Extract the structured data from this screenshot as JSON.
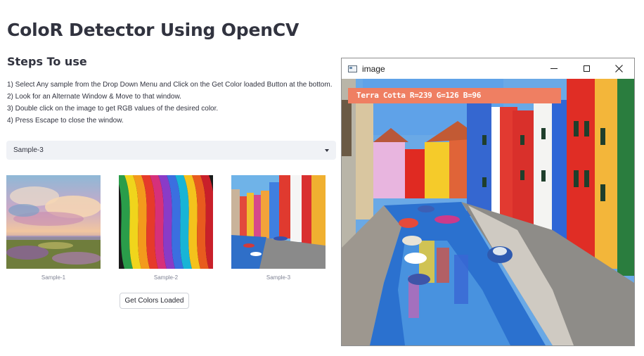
{
  "page": {
    "title": "ColoR Detector Using OpenCV",
    "steps_heading": "Steps To use",
    "steps": [
      "1) Select Any sample from the Drop Down Menu and Click on the Get Color loaded Button at the bottom.",
      "2) Look for an Alternate Window & Move to that window.",
      "3) Double click on the image to get RGB values of the desired color.",
      "4) Press Escape to close the window."
    ]
  },
  "dropdown": {
    "selected": "Sample-3"
  },
  "samples": [
    {
      "caption": "Sample-1"
    },
    {
      "caption": "Sample-2"
    },
    {
      "caption": "Sample-3"
    }
  ],
  "button": {
    "label": "Get Colors Loaded"
  },
  "window": {
    "title": "image",
    "color_readout": "Terra Cotta R=239 G=126 B=96",
    "readout_color": "#ef7f62"
  }
}
